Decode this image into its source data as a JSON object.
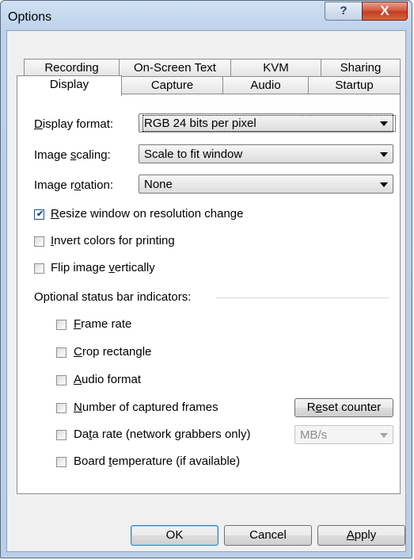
{
  "window": {
    "title": "Options",
    "help_label": "?",
    "close_label": "X"
  },
  "tabs_top": [
    {
      "label": "Recording"
    },
    {
      "label": "On-Screen Text"
    },
    {
      "label": "KVM"
    },
    {
      "label": "Sharing"
    }
  ],
  "tabs_bottom": [
    {
      "label": "Display",
      "active": true
    },
    {
      "label": "Capture"
    },
    {
      "label": "Audio"
    },
    {
      "label": "Startup"
    }
  ],
  "display": {
    "format_label_u": "D",
    "format_label_rest": "isplay format:",
    "format_value": "RGB 24 bits per pixel",
    "scaling_label_a": "Image ",
    "scaling_label_u": "s",
    "scaling_label_b": "caling:",
    "scaling_value": "Scale to fit window",
    "rotation_label_a": "Image r",
    "rotation_label_u": "o",
    "rotation_label_b": "tation:",
    "rotation_value": "None",
    "resize": {
      "u": "R",
      "rest": "esize window on resolution change",
      "checked": true
    },
    "invert": {
      "u": "I",
      "rest": "nvert colors for printing",
      "checked": false
    },
    "flip": {
      "a": "Flip image ",
      "u": "v",
      "b": "ertically",
      "checked": false
    },
    "status_group_label": "Optional status bar indicators:",
    "frame_rate": {
      "u": "F",
      "rest": "rame rate",
      "checked": false
    },
    "crop": {
      "u": "C",
      "rest": "rop rectangle",
      "checked": false
    },
    "audio_format": {
      "u": "A",
      "rest": "udio format",
      "checked": false
    },
    "captured_frames": {
      "u": "N",
      "rest": "umber of captured frames",
      "checked": false
    },
    "reset_counter": {
      "a": "R",
      "u": "e",
      "b": "set counter"
    },
    "data_rate": {
      "a": "Da",
      "u": "t",
      "b": "a rate (network grabbers only)",
      "checked": false
    },
    "data_rate_unit": "MB/s",
    "board_temp": {
      "a": "Board ",
      "u": "t",
      "b": "emperature (if available)",
      "checked": false
    }
  },
  "buttons": {
    "ok": "OK",
    "cancel": "Cancel",
    "apply_u": "A",
    "apply_rest": "pply"
  }
}
